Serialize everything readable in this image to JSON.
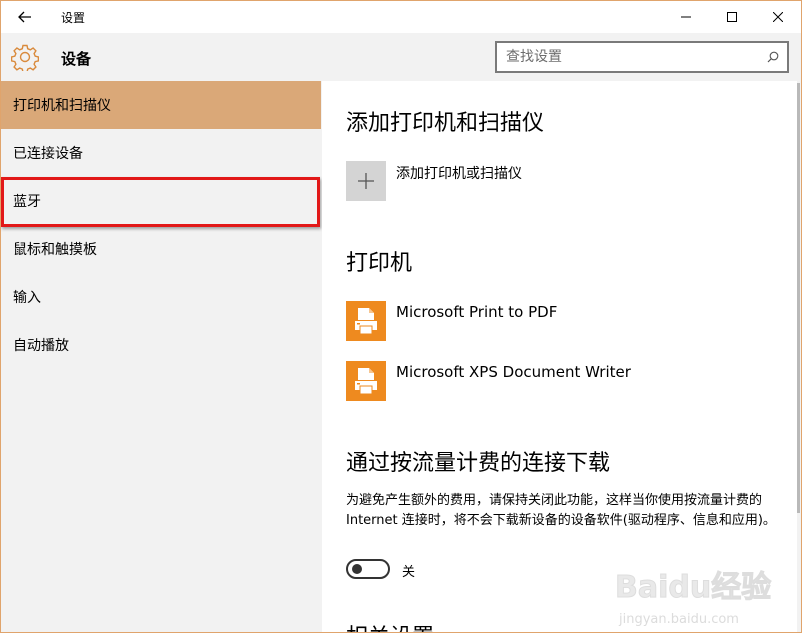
{
  "window": {
    "title": "设置",
    "back_icon": "back-arrow-icon",
    "minimize_icon": "minimize-icon",
    "maximize_icon": "maximize-icon",
    "close_icon": "close-icon"
  },
  "header": {
    "section_title": "设备",
    "gear_icon": "gear-icon",
    "search_placeholder": "查找设置",
    "search_icon": "search-icon"
  },
  "sidebar": {
    "items": [
      {
        "label": "打印机和扫描仪",
        "active": true
      },
      {
        "label": "已连接设备",
        "active": false
      },
      {
        "label": "蓝牙",
        "active": false,
        "highlighted": true
      },
      {
        "label": "鼠标和触摸板",
        "active": false
      },
      {
        "label": "输入",
        "active": false
      },
      {
        "label": "自动播放",
        "active": false
      }
    ]
  },
  "main": {
    "add_section_title": "添加打印机和扫描仪",
    "add_button_label": "添加打印机或扫描仪",
    "printers_title": "打印机",
    "printers": [
      {
        "name": "Microsoft Print to PDF"
      },
      {
        "name": "Microsoft XPS Document Writer"
      }
    ],
    "metered_title": "通过按流量计费的连接下载",
    "metered_description": "为避免产生额外的费用，请保持关闭此功能，这样当你使用按流量计费的 Internet 连接时，将不会下载新设备的设备软件(驱动程序、信息和应用)。",
    "metered_toggle_state": "关",
    "related_title": "相关设置"
  },
  "colors": {
    "accent": "#daa878",
    "printer_tile": "#ee8a1f",
    "highlight_border": "#e21818",
    "window_border": "#e0a46c"
  },
  "watermark": {
    "text": "Baidu经验",
    "subtext": "jingyan.baidu.com"
  }
}
